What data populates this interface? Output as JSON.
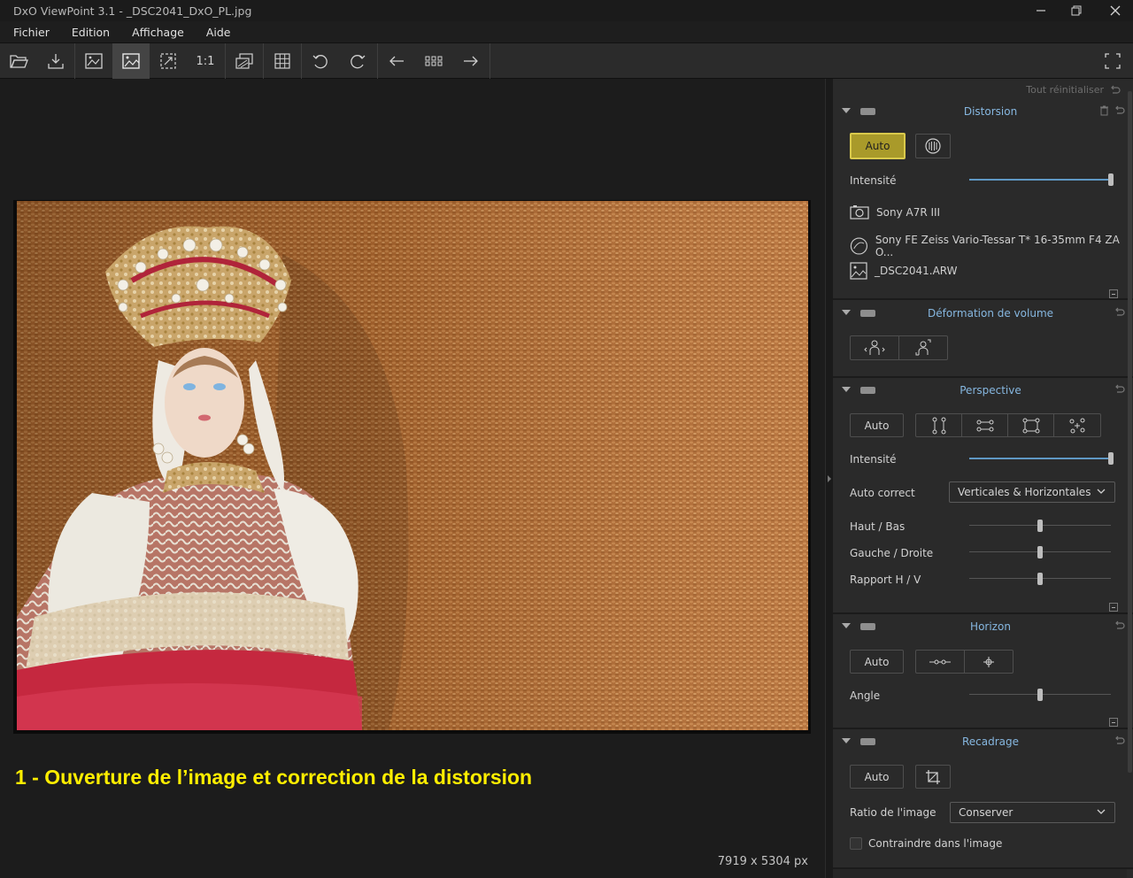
{
  "window": {
    "title": "DxO ViewPoint 3.1 - _DSC2041_DxO_PL.jpg"
  },
  "menu": {
    "items": [
      "Fichier",
      "Edition",
      "Affichage",
      "Aide"
    ]
  },
  "toolbar": {
    "zoom_1to1": "1:1"
  },
  "viewer": {
    "caption": "1 - Ouverture de l’image et correction de la distorsion",
    "dimensions": "7919 x 5304 px"
  },
  "panel": {
    "reset_all": "Tout réinitialiser",
    "distorsion": {
      "title": "Distorsion",
      "auto_label": "Auto",
      "intensity_label": "Intensité",
      "intensity_value": 1.0,
      "camera": "Sony A7R III",
      "lens": "Sony FE Zeiss Vario-Tessar T* 16-35mm F4 ZA O...",
      "file": "_DSC2041.ARW"
    },
    "volume": {
      "title": "Déformation de volume"
    },
    "perspective": {
      "title": "Perspective",
      "auto_label": "Auto",
      "intensity_label": "Intensité",
      "intensity_value": 1.0,
      "autocorrect_label": "Auto correct",
      "autocorrect_value": "Verticales & Horizontales",
      "haut_bas_label": "Haut / Bas",
      "gauche_droite_label": "Gauche / Droite",
      "rapport_label": "Rapport H / V"
    },
    "horizon": {
      "title": "Horizon",
      "auto_label": "Auto",
      "angle_label": "Angle"
    },
    "recadrage": {
      "title": "Recadrage",
      "auto_label": "Auto",
      "ratio_label": "Ratio de l'image",
      "ratio_value": "Conserver",
      "constrain_label": "Contraindre dans l'image",
      "constrain_checked": false
    }
  },
  "colors": {
    "accent_blue": "#86b7e0",
    "auto_active": "#a99a2a",
    "caption_yellow": "#ffee00"
  }
}
